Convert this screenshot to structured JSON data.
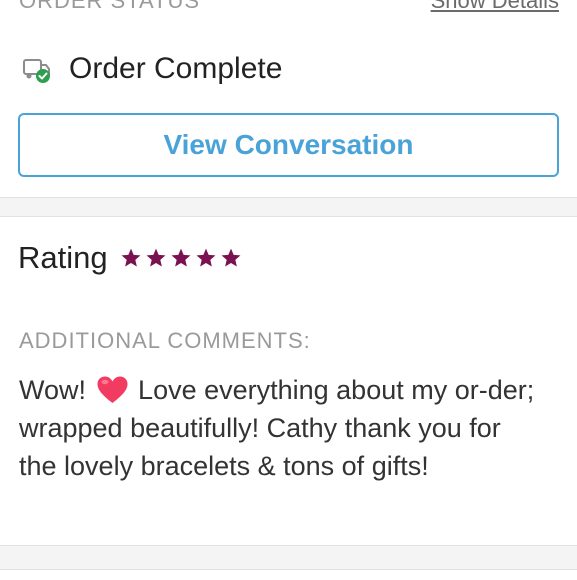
{
  "order": {
    "section_label": "ORDER STATUS",
    "show_details_label": "Show Details",
    "status_text": "Order Complete",
    "status_icon": "delivery-truck-check-icon",
    "view_conversation_label": "View Conversation"
  },
  "rating": {
    "label": "Rating",
    "stars": 5,
    "max_stars": 5,
    "star_color": "#7a1150"
  },
  "comments": {
    "label": "ADDITIONAL COMMENTS:",
    "text_before": "Wow!",
    "emoji": "heart-icon",
    "text_after": "Love everything about my or-der; wrapped beautifully! Cathy thank you for the lovely bracelets & tons of gifts!"
  },
  "colors": {
    "accent": "#4aa3d8",
    "success": "#2e9e4f",
    "heart": "#f23b61"
  }
}
